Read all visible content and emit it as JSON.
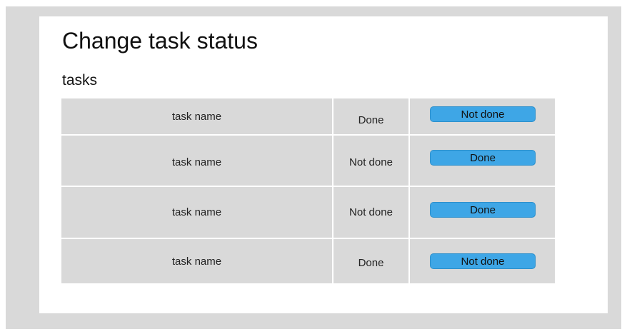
{
  "page": {
    "title": "Change task status",
    "section_label": "tasks"
  },
  "colors": {
    "frame_background": "#d9d9d9",
    "card_background": "#ffffff",
    "table_row_background": "#d9d9d9",
    "button_background": "#3ea6e6"
  },
  "tasks": [
    {
      "name": "task name",
      "status": "Done",
      "action_label": "Not done"
    },
    {
      "name": "task name",
      "status": "Not done",
      "action_label": "Done"
    },
    {
      "name": "task name",
      "status": "Not done",
      "action_label": "Done"
    },
    {
      "name": "task name",
      "status": "Done",
      "action_label": "Not done"
    }
  ]
}
